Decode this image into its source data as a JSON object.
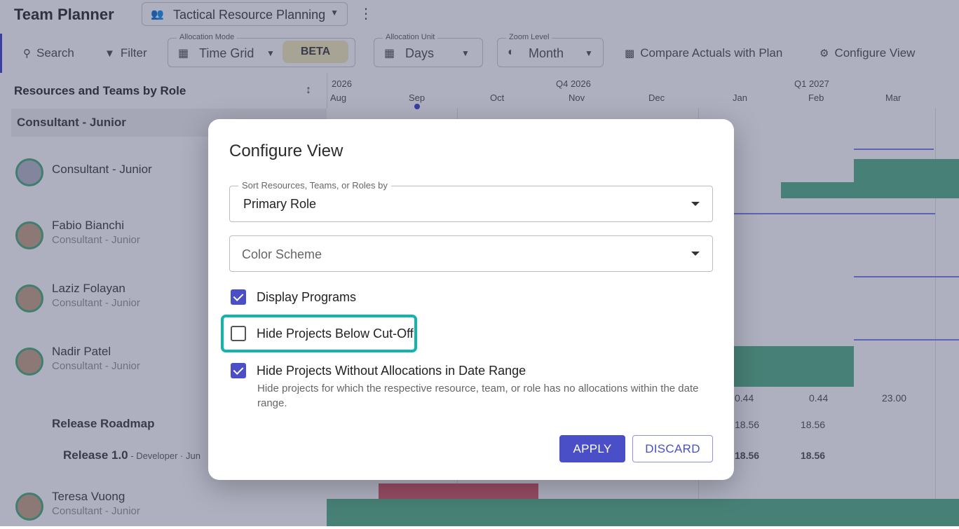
{
  "app": {
    "title": "Team Planner",
    "view_selector": {
      "label": "Tactical Resource Planning",
      "icon": "team-icon"
    }
  },
  "toolbar": {
    "search_label": "Search",
    "filter_label": "Filter",
    "allocation_mode": {
      "legend": "Allocation Mode",
      "value": "Time Grid",
      "badge": "BETA"
    },
    "allocation_unit": {
      "legend": "Allocation Unit",
      "value": "Days"
    },
    "zoom_level": {
      "legend": "Zoom Level",
      "value": "Month"
    },
    "compare_label": "Compare Actuals with Plan",
    "configure_label": "Configure View"
  },
  "left_panel": {
    "header": "Resources and Teams by Role",
    "group": "Consultant - Junior",
    "rows": [
      {
        "name": "Consultant - Junior",
        "role": ""
      },
      {
        "name": "Fabio Bianchi",
        "role": "Consultant - Junior"
      },
      {
        "name": "Laziz Folayan",
        "role": "Consultant - Junior"
      },
      {
        "name": "Nadir Patel",
        "role": "Consultant - Junior"
      },
      {
        "name": "Teresa Vuong",
        "role": "Consultant - Junior"
      }
    ],
    "program_row": "Release Roadmap",
    "project_row": {
      "name": "Release 1.0",
      "detail": " - Developer · Jun"
    }
  },
  "timeline": {
    "quarters": [
      "2026",
      "Q4 2026",
      "Q1 2027"
    ],
    "months": [
      "Aug",
      "Sep",
      "Oct",
      "Nov",
      "Dec",
      "Jan",
      "Feb",
      "Mar"
    ],
    "values_row1": [
      "0.44",
      "0.44",
      "23.00"
    ],
    "values_row2": [
      "18.56",
      "18.56"
    ],
    "values_row3": [
      "18.56",
      "18.56"
    ]
  },
  "dialog": {
    "title": "Configure View",
    "sort_field": {
      "label": "Sort Resources, Teams, or Roles by",
      "value": "Primary Role"
    },
    "color_field": {
      "placeholder": "Color Scheme"
    },
    "options": [
      {
        "label": "Display Programs",
        "checked": true
      },
      {
        "label": "Hide Projects Below Cut-Off",
        "checked": false
      },
      {
        "label": "Hide Projects Without Allocations in Date Range",
        "checked": true,
        "help": "Hide projects for which the respective resource, team, or role has no allocations within the date range."
      }
    ],
    "apply_label": "APPLY",
    "discard_label": "DISCARD"
  },
  "colors": {
    "accent": "#4a4fc8",
    "highlight": "#12b5ab",
    "allocation": "#59b38a",
    "over_allocation": "#d9606b"
  }
}
